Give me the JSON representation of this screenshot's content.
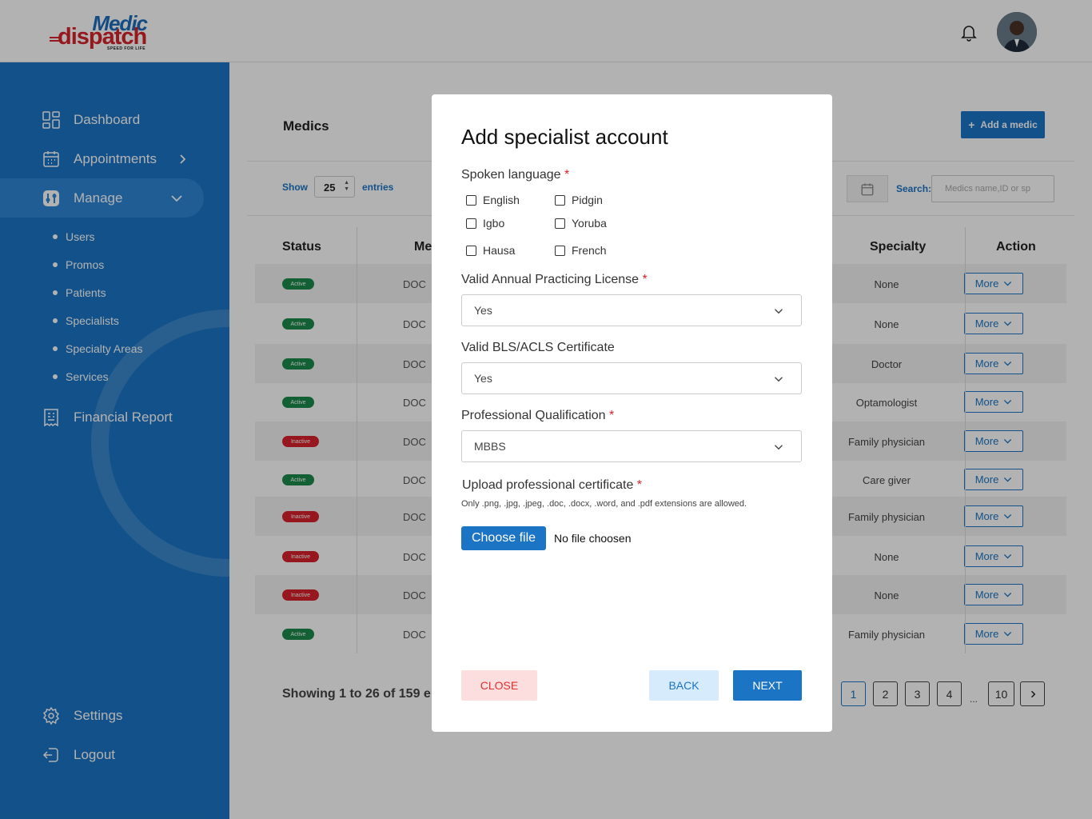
{
  "brand": {
    "logo_top": "Medic",
    "logo_main": "dispatch",
    "logo_tagline": "SPEED FOR LIFE"
  },
  "header": {
    "bell_icon": "bell-icon",
    "avatar": "user-avatar"
  },
  "sidebar": {
    "items": [
      {
        "label": "Dashboard",
        "icon": "dashboard-icon"
      },
      {
        "label": "Appointments",
        "icon": "calendar-icon"
      },
      {
        "label": "Manage",
        "icon": "manage-icon"
      },
      {
        "label": "Financial Report",
        "icon": "report-icon"
      },
      {
        "label": "Settings",
        "icon": "gear-icon"
      },
      {
        "label": "Logout",
        "icon": "logout-icon"
      }
    ],
    "sub_items": [
      "Users",
      "Promos",
      "Patients",
      "Specialists",
      "Specialty Areas",
      "Services"
    ]
  },
  "page": {
    "title": "Medics",
    "add_label": "Add a medic",
    "show_label": "Show",
    "show_value": "25",
    "entries_label": "entries",
    "search_label": "Search:",
    "search_placeholder": "Medics name,ID or sp",
    "columns": {
      "status": "Status",
      "medic": "Me",
      "specialty": "Specialty",
      "action": "Action"
    },
    "rows": [
      {
        "status": "Active",
        "doc": "DOC",
        "specialty": "None",
        "action": "More"
      },
      {
        "status": "Active",
        "doc": "DOC",
        "specialty": "None",
        "action": "More"
      },
      {
        "status": "Active",
        "doc": "DOC",
        "specialty": "Doctor",
        "action": "More"
      },
      {
        "status": "Active",
        "doc": "DOC",
        "specialty": "Optamologist",
        "action": "More"
      },
      {
        "status": "Inactive",
        "doc": "DOC",
        "specialty": "Family physician",
        "action": "More"
      },
      {
        "status": "Active",
        "doc": "DOC",
        "specialty": "Care giver",
        "action": "More"
      },
      {
        "status": "Inactive",
        "doc": "DOC",
        "specialty": "Family physician",
        "action": "More"
      },
      {
        "status": "Inactive",
        "doc": "DOC",
        "specialty": "None",
        "action": "More"
      },
      {
        "status": "Inactive",
        "doc": "DOC",
        "specialty": "None",
        "action": "More"
      },
      {
        "status": "Active",
        "doc": "DOC",
        "specialty": "Family physician",
        "action": "More"
      }
    ],
    "showing": "Showing 1 to 26 of 159 en",
    "pagination": [
      "1",
      "2",
      "3",
      "4",
      "...",
      "10"
    ],
    "current_page": "1"
  },
  "modal": {
    "title": "Add specialist account",
    "spoken_language_label": "Spoken language",
    "languages": [
      "English",
      "Pidgin",
      "Igbo",
      "Yoruba",
      "Hausa",
      "French"
    ],
    "license_label": "Valid Annual Practicing License",
    "license_value": "Yes",
    "bls_label": "Valid BLS/ACLS Certificate",
    "bls_value": "Yes",
    "qualification_label": "Professional Qualification",
    "qualification_value": "MBBS",
    "upload_label": "Upload professional certificate",
    "upload_note": "Only .png, .jpg, .jpeg, .doc, .docx, .word, and .pdf extensions are allowed.",
    "choose_file": "Choose file",
    "no_file": "No file choosen",
    "close": "CLOSE",
    "back": "BACK",
    "next": "NEXT",
    "required_mark": "*"
  },
  "colors": {
    "primary": "#1b74c4",
    "danger": "#d8222b",
    "success": "#1a8a4a"
  }
}
